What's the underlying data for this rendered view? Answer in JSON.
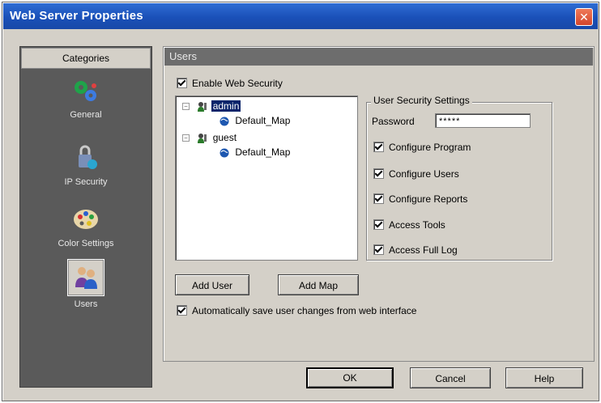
{
  "window": {
    "title": "Web Server Properties",
    "close_icon": "close-icon"
  },
  "categories": {
    "header": "Categories",
    "items": [
      {
        "label": "General",
        "icon": "general-gears-icon",
        "selected": false
      },
      {
        "label": "IP Security",
        "icon": "security-lock-icon",
        "selected": false
      },
      {
        "label": "Color Settings",
        "icon": "color-palette-icon",
        "selected": false
      },
      {
        "label": "Users",
        "icon": "users-icon",
        "selected": true
      }
    ]
  },
  "panel": {
    "header": "Users",
    "enable_security_label": "Enable Web Security",
    "enable_security_checked": true
  },
  "tree": {
    "users": [
      {
        "name": "admin",
        "map": "Default_Map",
        "selected": true
      },
      {
        "name": "guest",
        "map": "Default_Map",
        "selected": false
      }
    ]
  },
  "security_settings": {
    "group_label": "User Security Settings",
    "password_label": "Password",
    "password_value": "*****",
    "options": [
      {
        "label": "Configure Program",
        "checked": true
      },
      {
        "label": "Configure Users",
        "checked": true
      },
      {
        "label": "Configure Reports",
        "checked": true
      },
      {
        "label": "Access Tools",
        "checked": true
      },
      {
        "label": "Access Full Log",
        "checked": true
      }
    ]
  },
  "buttons": {
    "add_user": "Add User",
    "add_map": "Add Map",
    "ok": "OK",
    "cancel": "Cancel",
    "help": "Help"
  },
  "auto_save": {
    "label": "Automatically save user changes from web interface",
    "checked": true
  }
}
